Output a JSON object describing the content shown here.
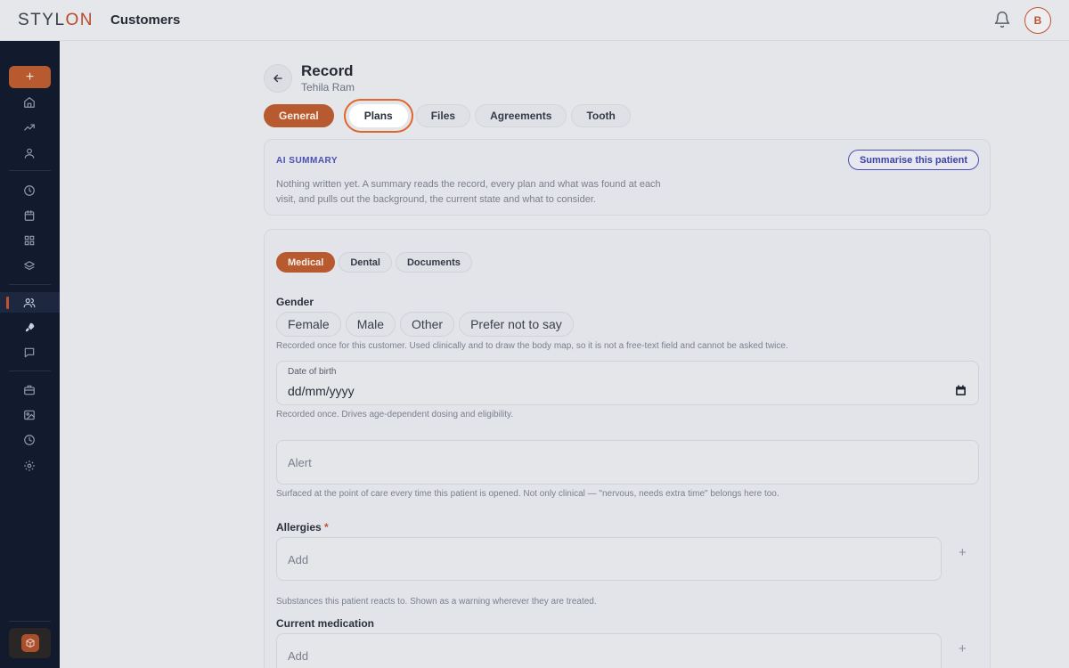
{
  "app": {
    "logo_main": "STYL",
    "logo_accent": "ON",
    "page_title": "Customers",
    "user_initial": "B"
  },
  "sidebar": {
    "add_label": "+",
    "items": [
      "home-icon",
      "trending-icon",
      "user-icon",
      "clock-icon",
      "calendar-icon",
      "grid-icon",
      "layers-icon",
      "users-icon",
      "rocket-icon",
      "chat-icon",
      "briefcase-icon",
      "image-icon",
      "history-icon",
      "settings-icon"
    ],
    "active_item": "users-icon"
  },
  "record": {
    "title": "Record",
    "subtitle": "Tehila Ram"
  },
  "tabs": [
    {
      "label": "General",
      "state": "active"
    },
    {
      "label": "Plans",
      "state": "highlighted"
    },
    {
      "label": "Files",
      "state": "default"
    },
    {
      "label": "Agreements",
      "state": "default"
    },
    {
      "label": "Tooth",
      "state": "default"
    }
  ],
  "ai_summary": {
    "label": "AI SUMMARY",
    "text": "Nothing written yet. A summary reads the record, every plan and what was found at each visit, and pulls out the background, the current state and what to consider.",
    "button": "Summarise this patient"
  },
  "subtabs": [
    {
      "label": "Medical",
      "state": "active"
    },
    {
      "label": "Dental",
      "state": "default"
    },
    {
      "label": "Documents",
      "state": "default"
    }
  ],
  "form": {
    "gender": {
      "label": "Gender",
      "options": [
        "Female",
        "Male",
        "Other",
        "Prefer not to say"
      ],
      "help": "Recorded once for this customer. Used clinically and to draw the body map, so it is not a free-text field and cannot be asked twice."
    },
    "dob": {
      "label": "Date of birth",
      "value": "dd/mm/yyyy",
      "help": "Recorded once. Drives age-dependent dosing and eligibility."
    },
    "alert": {
      "placeholder": "Alert",
      "help": "Surfaced at the point of care every time this patient is opened. Not only clinical — \"nervous, needs extra time\" belongs here too."
    },
    "allergies": {
      "label": "Allergies",
      "required_mark": "*",
      "placeholder": "Add",
      "add_label": "+",
      "help": "Substances this patient reacts to. Shown as a warning wherever they are treated."
    },
    "medication": {
      "label": "Current medication",
      "placeholder": "Add",
      "add_label": "+"
    }
  },
  "colors": {
    "accent": "#b85a30",
    "sidebar_bg": "#121b2e",
    "ai_accent": "#4c51b0"
  }
}
